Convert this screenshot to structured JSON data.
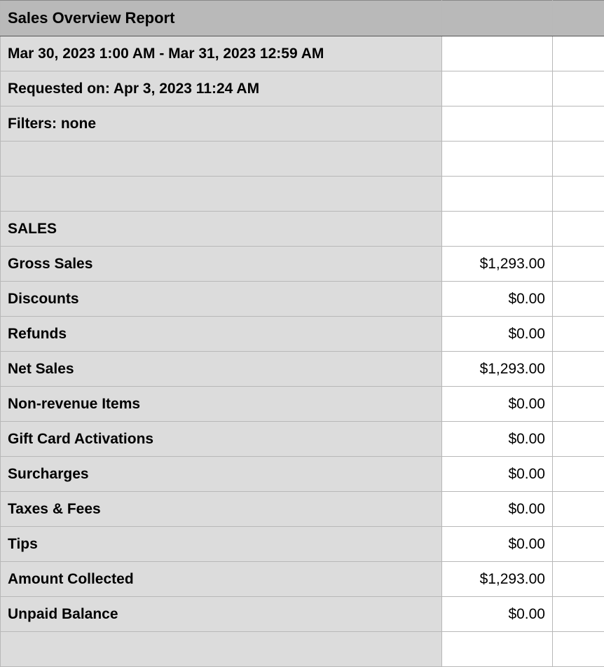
{
  "report": {
    "title": "Sales Overview Report",
    "date_range": "Mar 30, 2023 1:00 AM - Mar 31, 2023 12:59 AM",
    "requested_on": "Requested on: Apr 3, 2023 11:24 AM",
    "filters": "Filters: none",
    "section_header": "SALES",
    "rows": [
      {
        "label": "Gross Sales",
        "value": "$1,293.00"
      },
      {
        "label": "Discounts",
        "value": "$0.00"
      },
      {
        "label": "Refunds",
        "value": "$0.00"
      },
      {
        "label": "Net Sales",
        "value": "$1,293.00"
      },
      {
        "label": "Non-revenue Items",
        "value": "$0.00"
      },
      {
        "label": "Gift Card Activations",
        "value": "$0.00"
      },
      {
        "label": "Surcharges",
        "value": "$0.00"
      },
      {
        "label": "Taxes & Fees",
        "value": "$0.00"
      },
      {
        "label": "Tips",
        "value": "$0.00"
      },
      {
        "label": "Amount Collected",
        "value": "$1,293.00"
      },
      {
        "label": "Unpaid Balance",
        "value": "$0.00"
      }
    ]
  }
}
